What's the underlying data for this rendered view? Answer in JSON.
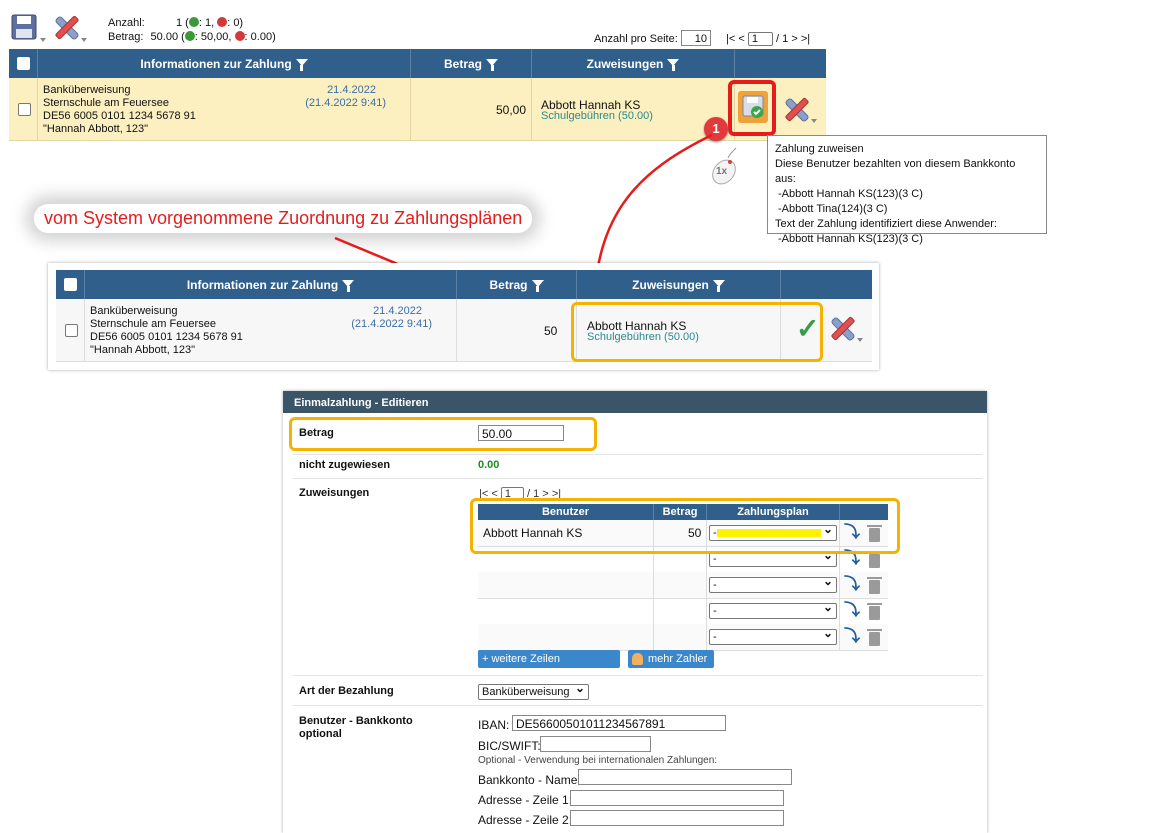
{
  "top": {
    "anzahl_label": "Anzahl:",
    "anzahl_value": "1 (",
    "anzahl_plus": ": 1,",
    "anzahl_minus": ": 0)",
    "betrag_label": "Betrag:",
    "betrag_value": "50.00 (",
    "betrag_plus": ": 50,00,",
    "betrag_minus": ": 0.00)",
    "per_page_label": "Anzahl pro Seite:",
    "per_page_value": "10",
    "pager_first": "|<",
    "pager_prev": "<",
    "pager_page": "1",
    "pager_of": "/ 1",
    "pager_next": ">",
    "pager_last": ">|"
  },
  "table1": {
    "col_info": "Informationen zur Zahlung",
    "col_betrag": "Betrag",
    "col_zuweisungen": "Zuweisungen",
    "row": {
      "line1": "Banküberweisung",
      "line2": "Sternschule am Feuersee",
      "line3": "DE56 6005 0101 1234 5678 91",
      "line4": "\"Hannah Abbott, 123\"",
      "date": "21.4.2022",
      "datetime": "(21.4.2022 9:41)",
      "betrag": "50,00",
      "zuweisung_name": "Abbott Hannah KS",
      "zuweisung_plan": "Schulgebühren (50.00)"
    }
  },
  "callout_number": "1",
  "mouse_label": "1x",
  "tooltip": {
    "line1": "Zahlung zuweisen",
    "line2": "Diese Benutzer bezahlten von diesem Bankkonto aus:",
    "line3": "-Abbott Hannah KS(123)(3 C)",
    "line4": "-Abbott Tina(124)(3 C)",
    "line5": "Text der Zahlung identifiziert diese Anwender:",
    "line6": "-Abbott Hannah KS(123)(3 C)"
  },
  "annotation": "vom System vorgenommene Zuordnung zu Zahlungsplänen",
  "table2": {
    "col_info": "Informationen zur Zahlung",
    "col_betrag": "Betrag",
    "col_zuweisungen": "Zuweisungen",
    "row": {
      "line1": "Banküberweisung",
      "line2": "Sternschule am Feuersee",
      "line3": "DE56 6005 0101 1234 5678 91",
      "line4": "\"Hannah Abbott, 123\"",
      "date": "21.4.2022",
      "datetime": "(21.4.2022 9:41)",
      "betrag_partial": "50",
      "zuweisung_name": "Abbott Hannah KS",
      "zuweisung_plan": "Schulgebühren (50.00)"
    }
  },
  "form": {
    "title": "Einmalzahlung - Editieren",
    "betrag_label": "Betrag",
    "betrag_value": "50.00",
    "nicht_label": "nicht zugewiesen",
    "nicht_value": "0.00",
    "zuweisungen_label": "Zuweisungen",
    "pager_first": "|<",
    "pager_prev": "<",
    "pager_page": "1",
    "pager_of": "/ 1",
    "pager_next": ">",
    "pager_last": ">|",
    "col_benutzer": "Benutzer",
    "col_betrag": "Betrag",
    "col_plan": "Zahlungsplan",
    "rows": [
      {
        "benutzer": "Abbott Hannah KS",
        "betrag": "50",
        "plan": "-"
      },
      {
        "benutzer": "",
        "betrag": "",
        "plan": "-"
      },
      {
        "benutzer": "",
        "betrag": "",
        "plan": "-"
      },
      {
        "benutzer": "",
        "betrag": "",
        "plan": "-"
      },
      {
        "benutzer": "",
        "betrag": "",
        "plan": "-"
      }
    ],
    "add_rows_button": "+ weitere Zeilen hinzufügen",
    "more_payers_button": "mehr Zahler",
    "art_label": "Art der Bezahlung",
    "art_value": "Banküberweisung",
    "bank_label_1": "Benutzer - Bankkonto",
    "bank_label_2": "optional",
    "iban_label": "IBAN:",
    "iban_value": "DE56600501011234567891",
    "bic_label": "BIC/SWIFT:",
    "bic_value": "",
    "optional_note": "Optional - Verwendung bei internationalen Zahlungen:",
    "bank_name_label": "Bankkonto - Name:",
    "addr1_label": "Adresse - Zeile 1:",
    "addr2_label": "Adresse - Zeile 2:"
  },
  "colors": {
    "header": "#2f5f8a",
    "highlight_row": "#fcefc0",
    "accent_orange": "#f5b200",
    "arrow_red": "#e51c1c"
  }
}
